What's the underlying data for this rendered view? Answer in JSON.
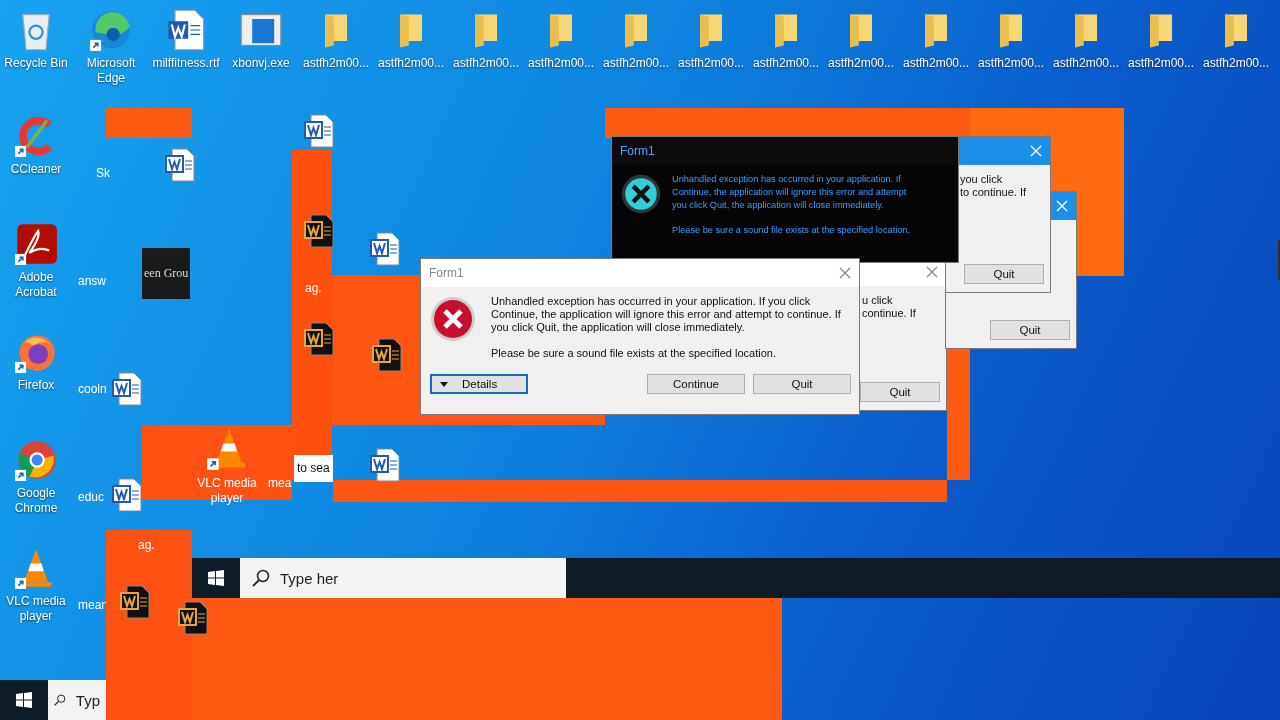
{
  "desktop": {
    "top_icons": [
      {
        "kind": "recycle",
        "label": "Recycle Bin"
      },
      {
        "kind": "edge",
        "label": "Microsoft Edge"
      },
      {
        "kind": "document",
        "label": "milffitness.rtf"
      },
      {
        "kind": "program",
        "label": "xbonvj.exe"
      },
      {
        "kind": "folder",
        "label": "astfh2m00..."
      },
      {
        "kind": "folder",
        "label": "astfh2m00..."
      },
      {
        "kind": "folder",
        "label": "astfh2m00..."
      },
      {
        "kind": "folder",
        "label": "astfh2m00..."
      },
      {
        "kind": "folder",
        "label": "astfh2m00..."
      },
      {
        "kind": "folder",
        "label": "astfh2m00..."
      },
      {
        "kind": "folder",
        "label": "astfh2m00..."
      },
      {
        "kind": "folder",
        "label": "astfh2m00..."
      },
      {
        "kind": "folder",
        "label": "astfh2m00..."
      },
      {
        "kind": "folder",
        "label": "astfh2m00..."
      },
      {
        "kind": "folder",
        "label": "astfh2m00..."
      },
      {
        "kind": "folder",
        "label": "astfh2m00..."
      },
      {
        "kind": "folder",
        "label": "astfh2m00..."
      }
    ],
    "left_icons": [
      {
        "kind": "ccleaner",
        "label": "CCleaner"
      },
      {
        "kind": "acrobat",
        "label": "Adobe Acrobat"
      },
      {
        "kind": "firefox",
        "label": "Firefox"
      },
      {
        "kind": "chrome",
        "label": "Google Chrome"
      },
      {
        "kind": "vlc",
        "label": "VLC media player"
      }
    ],
    "cut_labels": [
      "Sk",
      "answ",
      "cooln",
      "educ",
      "mean"
    ],
    "fragments": [
      {
        "kind": "banner",
        "text": "een Grou"
      },
      {
        "kind": "vlc",
        "text": "VLC media player"
      },
      {
        "kind": "plain",
        "text": "mea"
      },
      {
        "kind": "box",
        "text": "to sea"
      },
      {
        "kind": "plain",
        "text": "ag."
      },
      {
        "kind": "plain",
        "text": "ag."
      }
    ]
  },
  "dark_dialog": {
    "title": "Form1",
    "lines": [
      "Unhandled exception has occurred in your application. If",
      "Continue, the application will ignore this error and attempt",
      "you click Quit, the application will close immediately."
    ],
    "note": "Please be sure a sound file exists at the specified location."
  },
  "back_dialogs": [
    {
      "lines": [
        "u click",
        "continue. If"
      ],
      "button": "Quit"
    },
    {
      "button": "Quit"
    },
    {
      "lines": [
        "you click",
        "to continue. If"
      ],
      "button": "Quit"
    }
  ],
  "error_dialog": {
    "title": "Form1",
    "message": "Unhandled exception has occurred in your application. If you click Continue, the application will ignore this error and attempt to continue. If you click Quit, the application will close immediately.",
    "note": "Please be sure a sound file exists at the specified location.",
    "buttons": [
      {
        "kind": "details",
        "label": "Details",
        "focused": true
      },
      {
        "kind": "plain",
        "label": "Continue",
        "focused": false
      },
      {
        "kind": "plain",
        "label": "Quit",
        "focused": false
      }
    ]
  },
  "glitch_taskbar": {
    "search_placeholder": "Type her"
  },
  "taskbar": {
    "search_placeholder": "Typ"
  }
}
